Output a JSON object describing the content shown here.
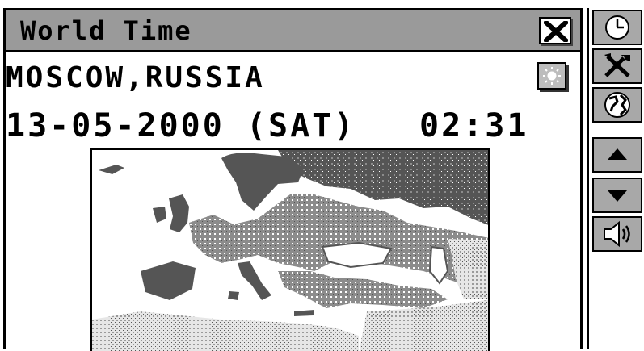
{
  "window": {
    "title": "World Time"
  },
  "location": {
    "city": "MOSCOW,RUSSIA"
  },
  "datetime": {
    "date": "13-05-2000 (SAT)",
    "time": "02:31"
  },
  "icons": {
    "close": "close-icon",
    "daylight": "sun-icon",
    "toolbar": [
      "clock-icon",
      "settings-tools-icon",
      "globe-icon",
      "arrow-up-icon",
      "arrow-down-icon",
      "speaker-icon"
    ]
  },
  "colors": {
    "title_bar": "#9a9a9a",
    "button_face": "#a8a8a8",
    "land_dark": "#555555",
    "land_mid": "#8c8c8c",
    "land_light": "#bdbdbd",
    "water": "#ffffff"
  }
}
